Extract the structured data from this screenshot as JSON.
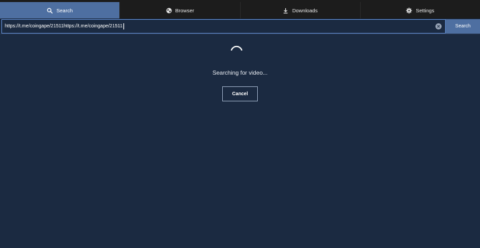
{
  "tabs": [
    {
      "label": "Search",
      "icon": "search-icon",
      "active": true
    },
    {
      "label": "Browser",
      "icon": "globe-icon",
      "active": false
    },
    {
      "label": "Downloads",
      "icon": "download-icon",
      "active": false
    },
    {
      "label": "Settings",
      "icon": "gear-icon",
      "active": false
    }
  ],
  "url_bar": {
    "value": "https://t.me/coingape/21511https://t.me/coingape/21511",
    "clear_icon": "clear-icon",
    "search_label": "Search"
  },
  "status": {
    "spinner_icon": "spinner-icon",
    "message": "Searching for video...",
    "cancel_label": "Cancel"
  },
  "colors": {
    "background": "#1b2a41",
    "tabbar": "#1c1c1c",
    "accent": "#4e6fa1",
    "field_border": "#5b84c4"
  }
}
